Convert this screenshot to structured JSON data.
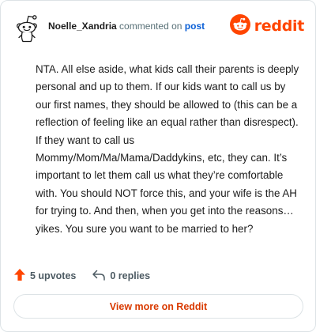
{
  "header": {
    "author": "Noelle_Xandria",
    "commented_text": "commented on",
    "post_link": "post",
    "avatar_icon": "snoo-avatar-icon",
    "logo_icon": "reddit-logo-icon",
    "logo_text": "reddit"
  },
  "comment": {
    "body": "NTA. All else aside, what kids call their parents is deeply personal and up to them. If our kids want to call us by our first names, they should be allowed to (this can be a reflection of feeling like an equal rather than disrespect). If they want to call us Mommy/Mom/Ma/Mama/Daddykins, etc, they can. It’s important to let them call us what they’re comfortable with. You should NOT force this, and your wife is the AH for trying to. And then, when you get into the reasons…yikes. You sure you want to be married to her?"
  },
  "actions": {
    "upvotes_label": "5 upvotes",
    "upvote_icon": "upvote-arrow-icon",
    "replies_label": "0 replies",
    "reply_icon": "reply-arrow-icon"
  },
  "footer": {
    "view_more_label": "View more on Reddit"
  },
  "colors": {
    "brand": "#ff4500",
    "link": "#0a5fd6",
    "button_text": "#d93a00",
    "border": "#dde3e6"
  }
}
